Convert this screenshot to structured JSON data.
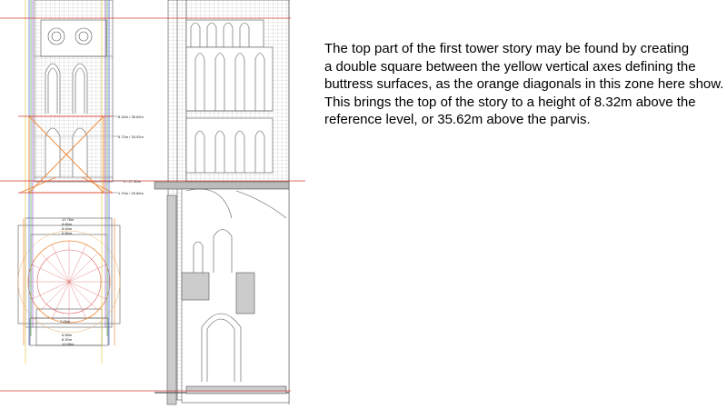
{
  "caption": {
    "lines": [
      "The top part of the first tower story may be found by creating",
      "a double square between the yellow vertical axes defining the",
      "buttress surfaces, as the orange diagonals in this zone here show.",
      "This brings the top of the story to a height of 8.32m above the",
      "reference level, or 35.62m above the parvis."
    ]
  },
  "dimension_labels": {
    "top_story": "8.32m / 35.62m",
    "mid_story": "5.72m / 33.02m",
    "base_story": "0 / 27.30m",
    "lower": "1.70m / 25.60m",
    "plan_1": "12.76m",
    "plan_2": "8.86m",
    "plan_3": "8.40m",
    "plan_4": "6.86m",
    "plan_5": "7.05m",
    "plan_6": "6.58m",
    "plan_7": "8.30m",
    "plan_8": "10.88m"
  },
  "colors": {
    "red_line": "#d63a3a",
    "orange": "#f08a3a",
    "yellow": "#e2c84a",
    "blue": "#4a6ad8",
    "green": "#5aa85a",
    "purple": "#9a5ac8",
    "drawing_line": "#555555"
  }
}
